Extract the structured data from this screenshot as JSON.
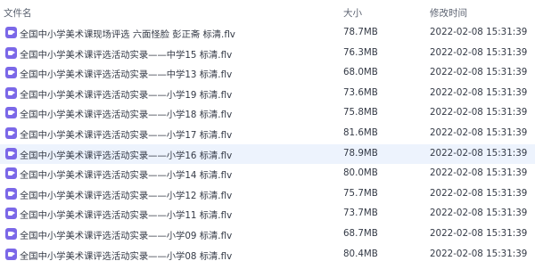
{
  "columns": {
    "name": "文件名",
    "size": "大小",
    "modified": "修改时间"
  },
  "rows": [
    {
      "name": "全国中小学美术课现场评选 六面怪脸 彭正斋 标清.flv",
      "size": "78.7MB",
      "modified": "2022-02-08 15:31:39"
    },
    {
      "name": "全国中小学美术课评选活动实录——中学15 标清.flv",
      "size": "76.3MB",
      "modified": "2022-02-08 15:31:39"
    },
    {
      "name": "全国中小学美术课评选活动实录——中学13 标清.flv",
      "size": "68.0MB",
      "modified": "2022-02-08 15:31:39"
    },
    {
      "name": "全国中小学美术课评选活动实录——小学19 标清.flv",
      "size": "73.6MB",
      "modified": "2022-02-08 15:31:39"
    },
    {
      "name": "全国中小学美术课评选活动实录——小学18 标清.flv",
      "size": "75.8MB",
      "modified": "2022-02-08 15:31:39"
    },
    {
      "name": "全国中小学美术课评选活动实录——小学17 标清.flv",
      "size": "81.6MB",
      "modified": "2022-02-08 15:31:39"
    },
    {
      "name": "全国中小学美术课评选活动实录——小学16 标清.flv",
      "size": "78.9MB",
      "modified": "2022-02-08 15:31:39"
    },
    {
      "name": "全国中小学美术课评选活动实录——小学14 标清.flv",
      "size": "80.0MB",
      "modified": "2022-02-08 15:31:39"
    },
    {
      "name": "全国中小学美术课评选活动实录——小学12 标清.flv",
      "size": "75.7MB",
      "modified": "2022-02-08 15:31:39"
    },
    {
      "name": "全国中小学美术课评选活动实录——小学11 标清.flv",
      "size": "73.7MB",
      "modified": "2022-02-08 15:31:39"
    },
    {
      "name": "全国中小学美术课评选活动实录——小学09 标清.flv",
      "size": "68.7MB",
      "modified": "2022-02-08 15:31:39"
    },
    {
      "name": "全国中小学美术课评选活动实录——小学08 标清.flv",
      "size": "80.4MB",
      "modified": "2022-02-08 15:31:39"
    }
  ],
  "selected_row": 6,
  "colors": {
    "row_highlight": "#edf3fd",
    "video_icon": "#7b68e8"
  },
  "icons": {
    "file": "video-file-icon"
  }
}
